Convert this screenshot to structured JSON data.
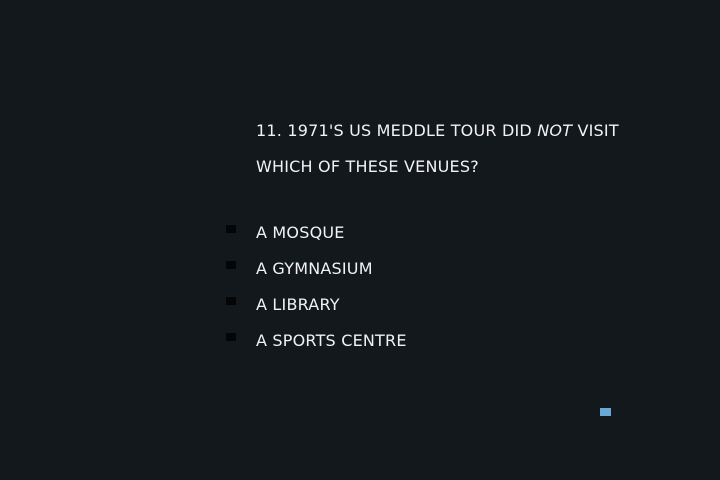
{
  "question": {
    "line1_prefix": "11. 1971'S US MEDDLE TOUR DID",
    "emphasis": "NOT",
    "line1_suffix": "VISIT",
    "line2": "WHICH OF THESE VENUES?"
  },
  "options": [
    {
      "label": "A MOSQUE"
    },
    {
      "label": "A GYMNASIUM"
    },
    {
      "label": "A LIBRARY"
    },
    {
      "label": "A SPORTS CENTRE"
    }
  ],
  "colors": {
    "background": "#13181d",
    "text": "#f2f2f2",
    "bullet": "#030506",
    "accent": "#6aa8d6"
  }
}
